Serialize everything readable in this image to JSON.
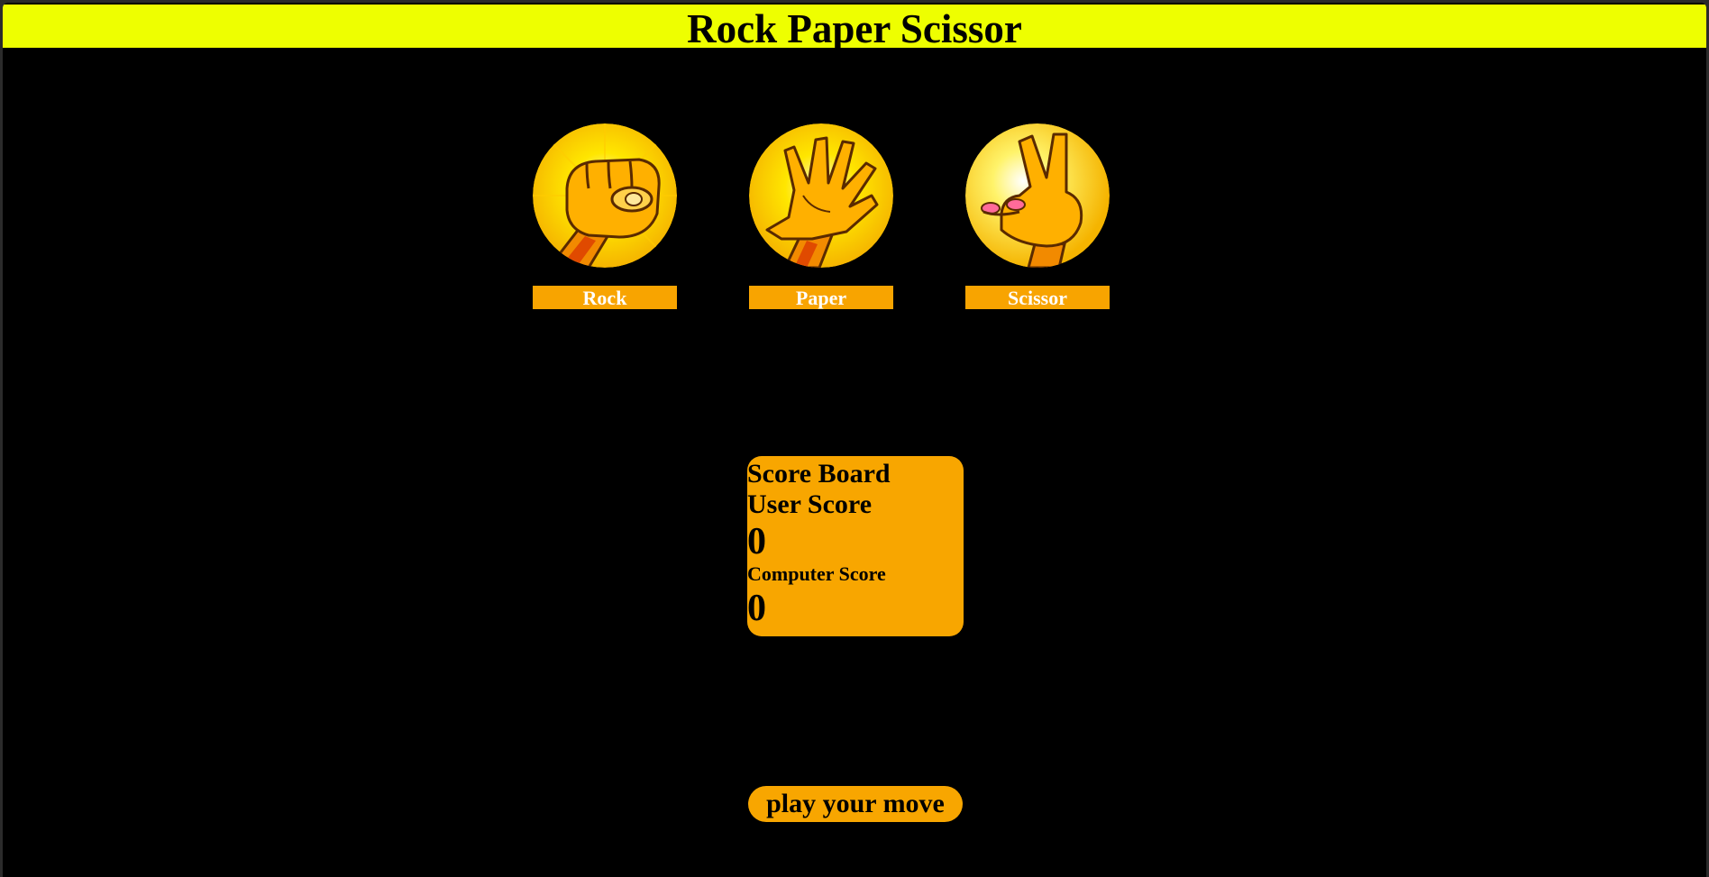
{
  "header": {
    "title": "Rock Paper Scissor"
  },
  "choices": [
    {
      "label": "Rock",
      "icon": "rock-fist-icon"
    },
    {
      "label": "Paper",
      "icon": "paper-open-hand-icon"
    },
    {
      "label": "Scissor",
      "icon": "scissor-hand-icon"
    }
  ],
  "scoreboard": {
    "title": "Score Board",
    "user_label": "User Score",
    "user_score": "0",
    "computer_label": "Computer Score",
    "computer_score": "0"
  },
  "action": {
    "play_label": "play your move"
  },
  "colors": {
    "header_bg": "#eeff00",
    "page_bg": "#000000",
    "accent": "#f8a600",
    "label_text": "#ffffff"
  }
}
